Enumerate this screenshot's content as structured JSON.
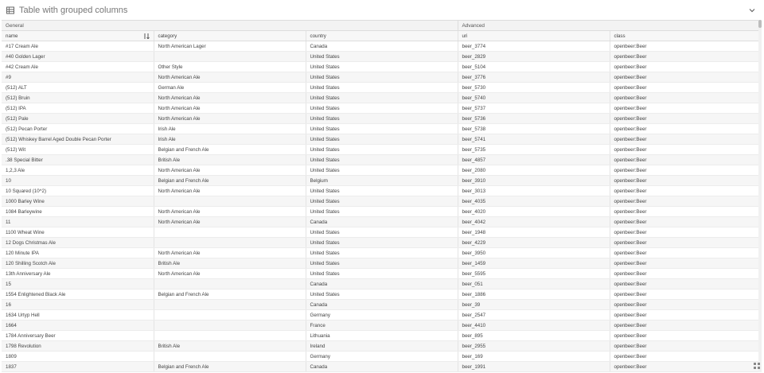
{
  "panel": {
    "title": "Table with grouped columns",
    "icons": {
      "title_icon": "table-icon",
      "collapse_icon": "chevron-down-icon",
      "sort_icon": "sort-icon",
      "grip_icon": "resize-grip-icon"
    }
  },
  "table": {
    "groups": [
      {
        "label": "General",
        "span": 3
      },
      {
        "label": "Advanced",
        "span": 2
      }
    ],
    "columns": [
      "name",
      "category",
      "country",
      "uri",
      "class"
    ],
    "rows": [
      [
        "#17 Cream Ale",
        "North American Lager",
        "Canada",
        "beer_3774",
        "openbeer:Beer"
      ],
      [
        "#40 Golden Lager",
        "",
        "United States",
        "beer_2829",
        "openbeer:Beer"
      ],
      [
        "#42 Cream Ale",
        "Other Style",
        "United States",
        "beer_5104",
        "openbeer:Beer"
      ],
      [
        "#9",
        "North American Ale",
        "United States",
        "beer_3776",
        "openbeer:Beer"
      ],
      [
        "(512) ALT",
        "German Ale",
        "United States",
        "beer_5730",
        "openbeer:Beer"
      ],
      [
        "(512) Bruin",
        "North American Ale",
        "United States",
        "beer_5740",
        "openbeer:Beer"
      ],
      [
        "(512) IPA",
        "North American Ale",
        "United States",
        "beer_5737",
        "openbeer:Beer"
      ],
      [
        "(512) Pale",
        "North American Ale",
        "United States",
        "beer_5736",
        "openbeer:Beer"
      ],
      [
        "(512) Pecan Porter",
        "Irish Ale",
        "United States",
        "beer_5738",
        "openbeer:Beer"
      ],
      [
        "(512) Whiskey Barrel Aged Double Pecan Porter",
        "Irish Ale",
        "United States",
        "beer_5741",
        "openbeer:Beer"
      ],
      [
        "(512) Wit",
        "Belgian and French Ale",
        "United States",
        "beer_5735",
        "openbeer:Beer"
      ],
      [
        ".38 Special Bitter",
        "British Ale",
        "United States",
        "beer_4857",
        "openbeer:Beer"
      ],
      [
        "1,2,3 Ale",
        "North American Ale",
        "United States",
        "beer_2080",
        "openbeer:Beer"
      ],
      [
        "10",
        "Belgian and French Ale",
        "Belgium",
        "beer_3910",
        "openbeer:Beer"
      ],
      [
        "10 Squared (10^2)",
        "North American Ale",
        "United States",
        "beer_3013",
        "openbeer:Beer"
      ],
      [
        "1000 Barley Wine",
        "",
        "United States",
        "beer_4035",
        "openbeer:Beer"
      ],
      [
        "1084 Barleywine",
        "North American Ale",
        "United States",
        "beer_4020",
        "openbeer:Beer"
      ],
      [
        "11",
        "North American Ale",
        "Canada",
        "beer_4042",
        "openbeer:Beer"
      ],
      [
        "1100 Wheat Wine",
        "",
        "United States",
        "beer_1948",
        "openbeer:Beer"
      ],
      [
        "12 Dogs Christmas Ale",
        "",
        "United States",
        "beer_4229",
        "openbeer:Beer"
      ],
      [
        "120 Minute IPA",
        "North American Ale",
        "United States",
        "beer_3950",
        "openbeer:Beer"
      ],
      [
        "120 Shilling Scotch Ale",
        "British Ale",
        "United States",
        "beer_1459",
        "openbeer:Beer"
      ],
      [
        "13th Anniversary Ale",
        "North American Ale",
        "United States",
        "beer_5595",
        "openbeer:Beer"
      ],
      [
        "15",
        "",
        "Canada",
        "beer_051",
        "openbeer:Beer"
      ],
      [
        "1554 Enlightened Black Ale",
        "Belgian and French Ale",
        "United States",
        "beer_1886",
        "openbeer:Beer"
      ],
      [
        "16",
        "",
        "Canada",
        "beer_39",
        "openbeer:Beer"
      ],
      [
        "1634 Urtyp Hell",
        "",
        "Germany",
        "beer_2547",
        "openbeer:Beer"
      ],
      [
        "1664",
        "",
        "France",
        "beer_4410",
        "openbeer:Beer"
      ],
      [
        "1784 Anniversary Beer",
        "",
        "Lithuania",
        "beer_895",
        "openbeer:Beer"
      ],
      [
        "1798 Revolution",
        "British Ale",
        "Ireland",
        "beer_2955",
        "openbeer:Beer"
      ],
      [
        "1809",
        "",
        "Germany",
        "beer_169",
        "openbeer:Beer"
      ],
      [
        "1837",
        "Belgian and French Ale",
        "Canada",
        "beer_1991",
        "openbeer:Beer"
      ]
    ]
  }
}
